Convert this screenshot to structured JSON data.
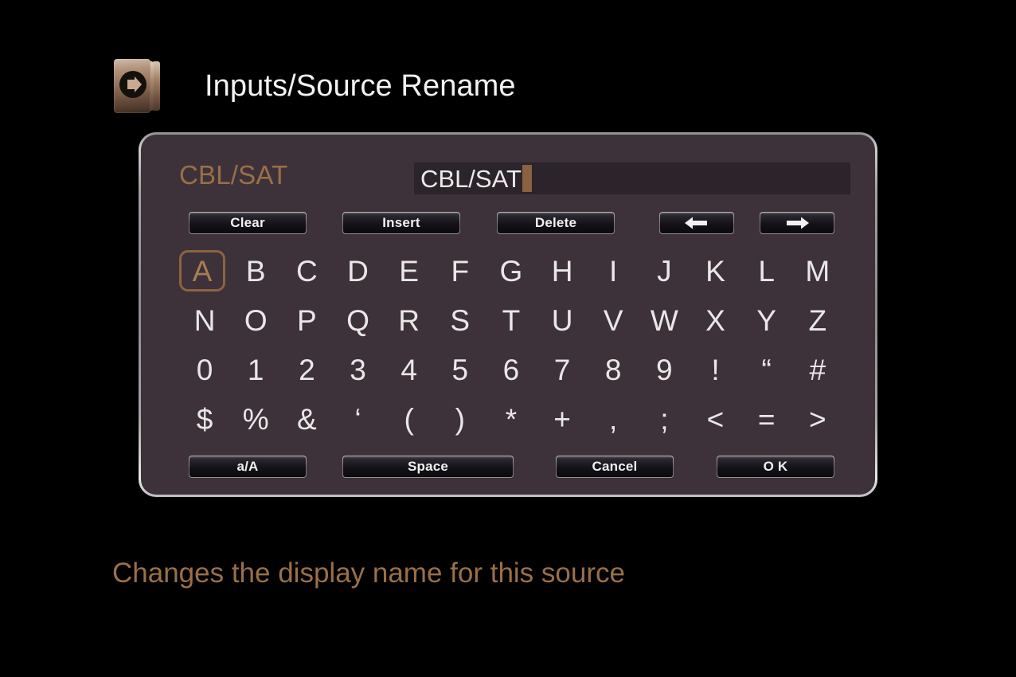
{
  "header": {
    "icon": "inputs-source-arrow-icon",
    "title": "Inputs/Source Rename"
  },
  "dialog": {
    "source_label": "CBL/SAT",
    "name_field": {
      "value": "CBL/SAT",
      "caret": true
    },
    "top_buttons": [
      {
        "id": "clear",
        "label": "Clear"
      },
      {
        "id": "insert",
        "label": "Insert"
      },
      {
        "id": "delete",
        "label": "Delete"
      },
      {
        "id": "left",
        "label": "←"
      },
      {
        "id": "right",
        "label": "→"
      }
    ],
    "bottom_buttons": [
      {
        "id": "case",
        "label": "a/A"
      },
      {
        "id": "space",
        "label": "Space"
      },
      {
        "id": "cancel",
        "label": "Cancel"
      },
      {
        "id": "ok",
        "label": "O K"
      }
    ],
    "keyboard": {
      "selected": "A",
      "rows": [
        [
          "A",
          "B",
          "C",
          "D",
          "E",
          "F",
          "G",
          "H",
          "I",
          "J",
          "K",
          "L",
          "M"
        ],
        [
          "N",
          "O",
          "P",
          "Q",
          "R",
          "S",
          "T",
          "U",
          "V",
          "W",
          "X",
          "Y",
          "Z"
        ],
        [
          "0",
          "1",
          "2",
          "3",
          "4",
          "5",
          "6",
          "7",
          "8",
          "9",
          "!",
          "“",
          "#"
        ],
        [
          "$",
          "%",
          "&",
          "‘",
          "(",
          ")",
          "*",
          "+",
          ",",
          ";",
          "<",
          "=",
          ">"
        ]
      ]
    }
  },
  "caption": "Changes the display name for this source",
  "colors": {
    "background": "#000000",
    "panel_fill": "#3d3239",
    "panel_border": "#cfcfd1",
    "accent_brown": "#9a6f48",
    "selection_border": "#8c6341",
    "caret": "#8a6141",
    "field_fill": "#2b242a",
    "text_light": "#e9e7e7"
  }
}
